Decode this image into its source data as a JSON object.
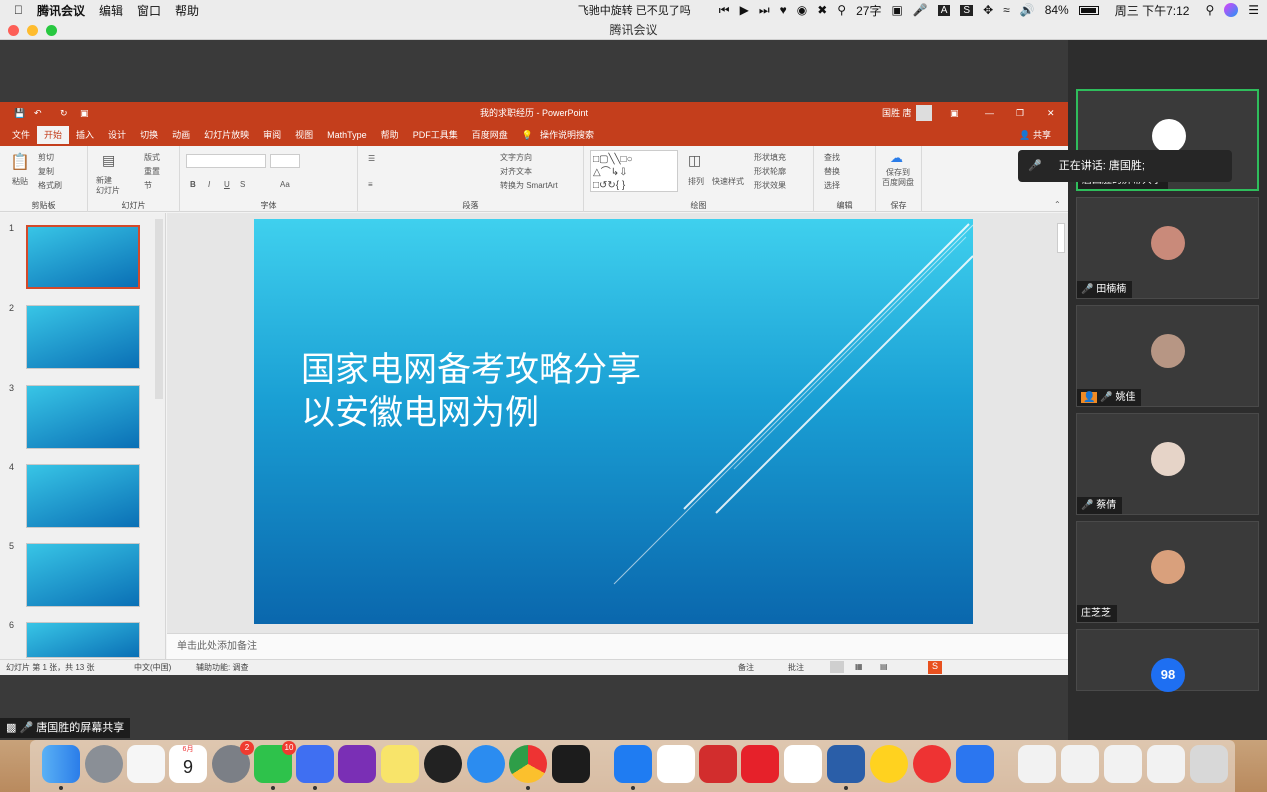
{
  "menubar": {
    "apple": "",
    "app": "腾讯会议",
    "menus": [
      "编辑",
      "窗口",
      "帮助"
    ],
    "now_playing": "飞驰中旋转 已不见了吗",
    "word_count": "27字",
    "battery": "84%",
    "clock": "周三 下午7:12"
  },
  "window": {
    "title": "腾讯会议"
  },
  "ppt": {
    "doc_title": "我的求职经历 - PowerPoint",
    "user": "国胜 唐",
    "tabs": [
      "文件",
      "开始",
      "插入",
      "设计",
      "切换",
      "动画",
      "幻灯片放映",
      "审阅",
      "视图",
      "MathType",
      "帮助",
      "PDF工具集",
      "百度网盘",
      "操作说明搜索"
    ],
    "share": "共享",
    "ribbon_groups": [
      "剪贴板",
      "幻灯片",
      "字体",
      "段落",
      "绘图",
      "编辑",
      "保存"
    ],
    "ribbon_items": {
      "paste": "粘贴",
      "cut": "剪切",
      "copy": "复制",
      "format_painter": "格式刷",
      "new_slide": "新建\n幻灯片",
      "layout": "版式",
      "reset": "重置",
      "section": "节",
      "text_direction": "文字方向",
      "align_text": "对齐文本",
      "smartart": "转换为 SmartArt",
      "arrange": "排列",
      "quick_styles": "快速样式",
      "shape_fill": "形状填充",
      "shape_outline": "形状轮廓",
      "shape_effects": "形状效果",
      "find": "查找",
      "replace": "替换",
      "select": "选择",
      "save_baidu": "保存到\n百度网盘"
    },
    "slide_numbers": [
      "1",
      "2",
      "3",
      "4",
      "5",
      "6"
    ],
    "slide_title_line1": "国家电网备考攻略分享",
    "slide_title_line2": "以安徽电网为例",
    "notes_placeholder": "单击此处添加备注",
    "status_left": "幻灯片 第 1 张，共 13 张",
    "status_lang": "中文(中国)",
    "status_access": "辅助功能: 调查",
    "status_notes": "备注",
    "status_comments": "批注"
  },
  "meeting": {
    "speaking": "正在讲话: 唐国胜;",
    "participants": [
      {
        "name": "唐国胜的屏幕共享"
      },
      {
        "name": "田楠楠"
      },
      {
        "name": "姚佳"
      },
      {
        "name": "蔡倩"
      },
      {
        "name": "庄芝芝"
      },
      {
        "name": "98"
      }
    ],
    "share_label": "唐国胜的屏幕共享"
  },
  "dock": {
    "calendar_month": "6月",
    "calendar_day": "9",
    "badge_settings": "2",
    "badge_wechat": "10",
    "apps": [
      "finder",
      "launchpad",
      "photos",
      "calendar",
      "system-preferences",
      "wechat",
      "wps",
      "onenote",
      "notes",
      "qq",
      "safari",
      "chrome",
      "pycharm",
      "tencent-meeting",
      "baidu-netdisk",
      "zotero",
      "youdao",
      "xmind",
      "word",
      "music",
      "netease-music",
      "feishu"
    ]
  },
  "colors": {
    "ppt_red": "#c43e1c",
    "active_green": "#2fbd5c"
  }
}
